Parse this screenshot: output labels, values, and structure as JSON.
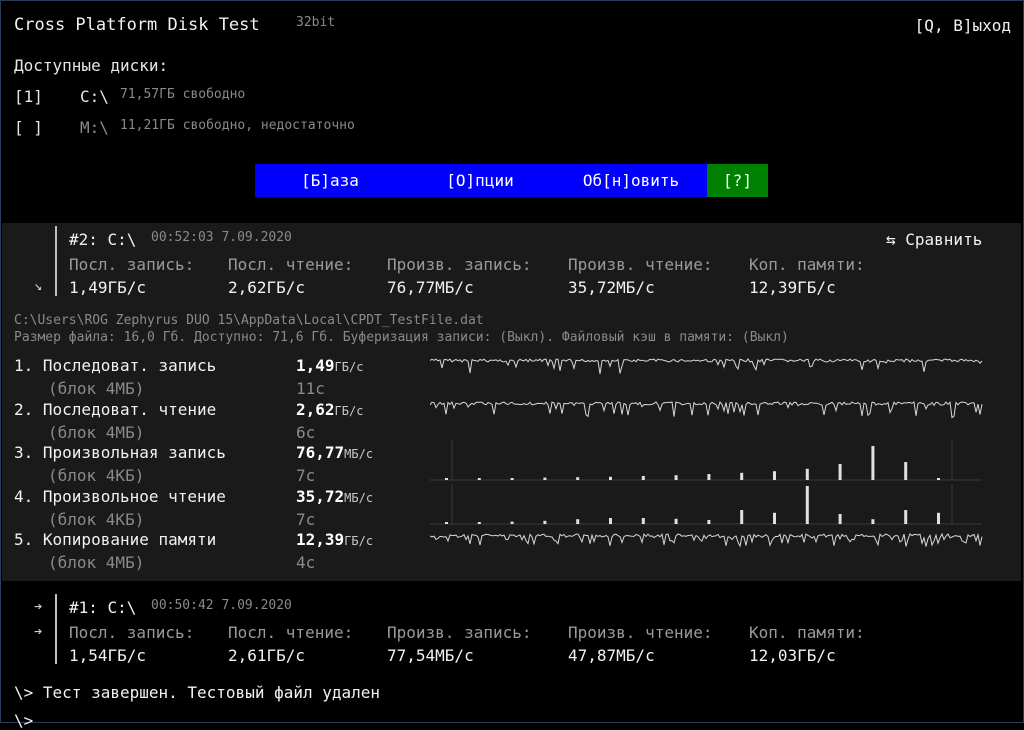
{
  "header": {
    "title": "Cross Platform Disk Test",
    "bits": "32bit",
    "quit": "[Q, В]ыход"
  },
  "disks": {
    "heading": "Доступные диски:",
    "items": [
      {
        "marker": "[1]",
        "name": "C:\\",
        "info": "71,57ГБ свободно"
      },
      {
        "marker": "[ ]",
        "name": "M:\\",
        "info": "11,21ГБ свободно, недостаточно"
      }
    ]
  },
  "menu": {
    "base": "[Б]аза",
    "options": "[О]пции",
    "refresh": "Об[н]овить",
    "help": "[?]"
  },
  "current": {
    "id": "#2: C:\\",
    "time": "00:52:03 7.09.2020",
    "compare": "⇆ Сравнить",
    "arrow": "↘",
    "labels": [
      "Посл. запись:",
      "Посл. чтение:",
      "Произв. запись:",
      "Произв. чтение:",
      "Коп. памяти:"
    ],
    "values": [
      "1,49ГБ/с",
      "2,62ГБ/с",
      "76,77МБ/с",
      "35,72МБ/с",
      "12,39ГБ/с"
    ],
    "path": "C:\\Users\\ROG Zephyrus DUO 15\\AppData\\Local\\CPDT_TestFile.dat",
    "info": "Размер файла: 16,0 Гб. Доступно: 71,6 Гб. Буферизация записи: (Выкл). Файловый кэш в памяти: (Выкл)",
    "tests": [
      {
        "name": "1. Последоват. запись",
        "sub": "(блок 4МБ)",
        "value": "1,49",
        "unit": "ГБ/с",
        "time": "11с"
      },
      {
        "name": "2. Последоват. чтение",
        "sub": "(блок 4МБ)",
        "value": "2,62",
        "unit": "ГБ/с",
        "time": "6с"
      },
      {
        "name": "3. Произвольная запись",
        "sub": "(блок 4КБ)",
        "value": "76,77",
        "unit": "МБ/с",
        "time": "7с"
      },
      {
        "name": "4. Произвольное чтение",
        "sub": "(блок 4КБ)",
        "value": "35,72",
        "unit": "МБ/с",
        "time": "7с"
      },
      {
        "name": "5. Копирование памяти",
        "sub": "(блок 4МБ)",
        "value": "12,39",
        "unit": "ГБ/с",
        "time": "4с"
      }
    ]
  },
  "previous": {
    "arrows": [
      "➔",
      "➔"
    ],
    "id": "#1: C:\\",
    "time": "00:50:42 7.09.2020",
    "labels": [
      "Посл. запись:",
      "Посл. чтение:",
      "Произв. запись:",
      "Произв. чтение:",
      "Коп. памяти:"
    ],
    "values": [
      "1,54ГБ/с",
      "2,61ГБ/с",
      "77,54МБ/с",
      "47,87МБ/с",
      "12,03ГБ/с"
    ]
  },
  "console": {
    "line1": "\\> Тест завершен. Тестовый файл удален",
    "line2": "\\>"
  },
  "colors": {
    "menu_bg": "#0000ff",
    "help_bg": "#008000",
    "panel_bg": "#1a1a1a"
  },
  "chart_data": [
    {
      "type": "line",
      "title": "Последоват. запись",
      "note": "throughput trace, mostly flat with occasional drops"
    },
    {
      "type": "line",
      "title": "Последоват. чтение",
      "note": "throughput trace, mostly flat with occasional drops"
    },
    {
      "type": "bar",
      "title": "Произвольная запись",
      "values": [
        0.02,
        0.03,
        0.05,
        0.06,
        0.07,
        0.08,
        0.1,
        0.12,
        0.15,
        0.18,
        0.22,
        0.28,
        0.4,
        0.85,
        0.45,
        0.05
      ]
    },
    {
      "type": "bar",
      "title": "Произвольное чтение",
      "values": [
        0.03,
        0.05,
        0.06,
        0.08,
        0.12,
        0.15,
        0.15,
        0.13,
        0.1,
        0.35,
        0.28,
        0.95,
        0.25,
        0.12,
        0.35,
        0.28
      ]
    },
    {
      "type": "line",
      "title": "Копирование памяти",
      "note": "throughput trace with frequent small dips"
    }
  ]
}
